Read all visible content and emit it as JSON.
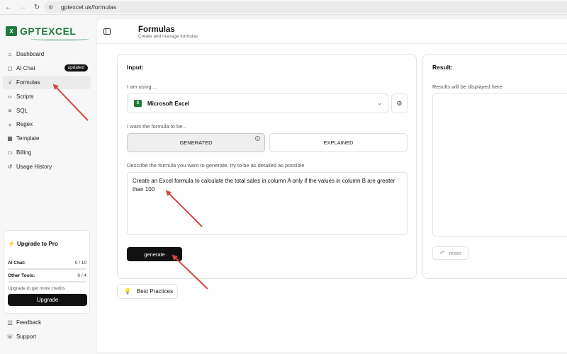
{
  "browser": {
    "url": "gptexcel.uk/formulas"
  },
  "sidebar": {
    "logo_text": "GPTEXCEL",
    "items": [
      {
        "label": "Dashboard",
        "icon": "home-icon"
      },
      {
        "label": "AI Chat",
        "icon": "chat-icon",
        "badge": "updated"
      },
      {
        "label": "Formulas",
        "icon": "sqrt-icon",
        "active": true
      },
      {
        "label": "Scripts",
        "icon": "code-icon"
      },
      {
        "label": "SQL",
        "icon": "database-icon"
      },
      {
        "label": "Regex",
        "icon": "regex-icon"
      },
      {
        "label": "Template",
        "icon": "grid-icon"
      },
      {
        "label": "Billing",
        "icon": "card-icon"
      },
      {
        "label": "Usage History",
        "icon": "history-icon"
      }
    ],
    "upgrade": {
      "title": "Upgrade to Pro",
      "ai_chat_label": "AI Chat:",
      "ai_chat_count": "0 / 10",
      "other_tools_label": "Other Tools:",
      "other_tools_count": "0 / 4",
      "note": "Upgrade to get more credits",
      "button": "Upgrade"
    },
    "footer_items": [
      {
        "label": "Feedback",
        "icon": "feedback-icon"
      },
      {
        "label": "Support",
        "icon": "support-icon"
      }
    ]
  },
  "header": {
    "title": "Formulas",
    "subtitle": "Create and manage formulas"
  },
  "input": {
    "title": "Input:",
    "using_label": "I am using ...",
    "app_selected": "Microsoft Excel",
    "mode_label": "I want the formula to be...",
    "mode_generated": "GENERATED",
    "mode_explained": "EXPLAINED",
    "describe_label": "Describe the formula you want to generate. try to be as detailed as possible",
    "prompt": "Create an Excel formula to calculate the total sales in column A only if the values in column B are greater than 100",
    "generate_button": "generate"
  },
  "best_practices": "Best Practices",
  "result": {
    "title": "Result:",
    "placeholder": "Results will be displayed here",
    "reset_button": "reset"
  },
  "colors": {
    "brand_green": "#1f7a3f",
    "annotation_arrow": "#d64541"
  }
}
